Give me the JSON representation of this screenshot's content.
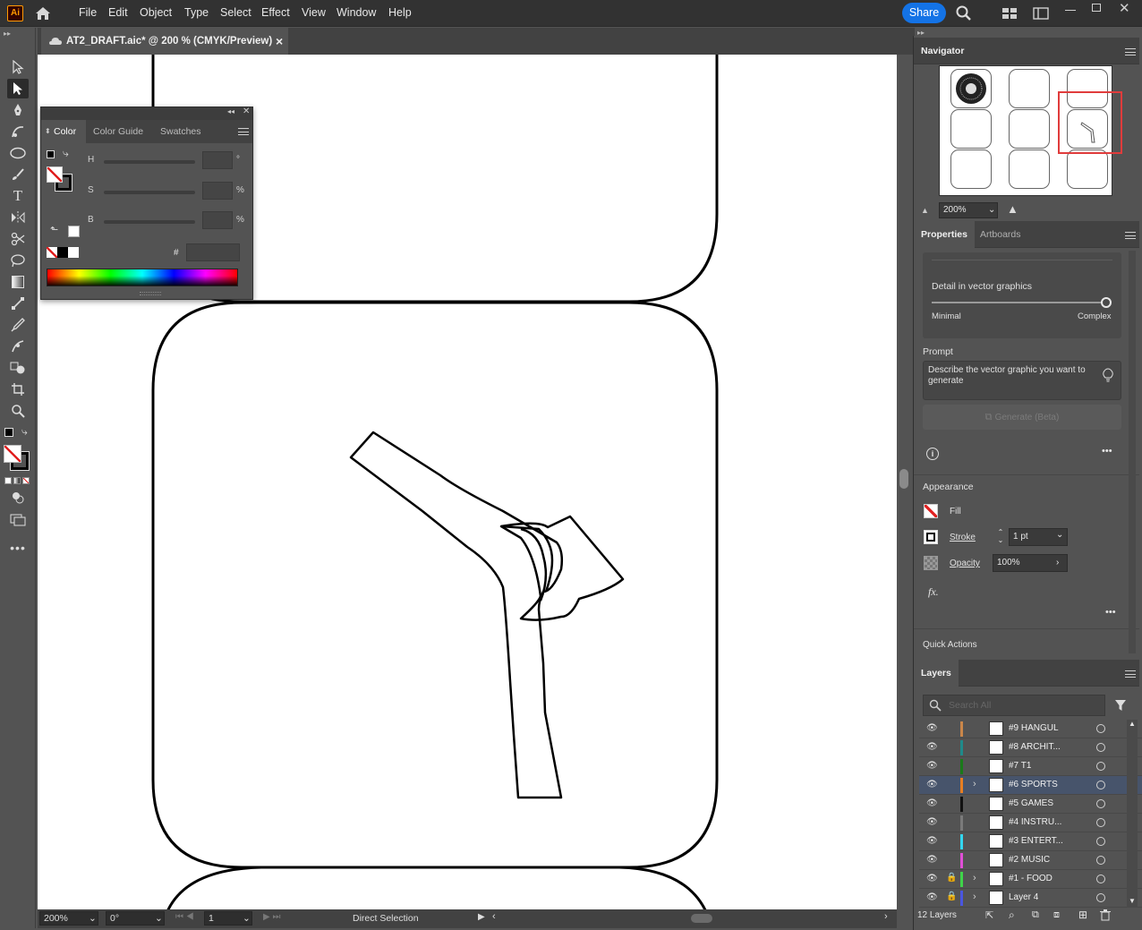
{
  "app": {
    "logo": "Ai",
    "share_label": "Share"
  },
  "menu": [
    "File",
    "Edit",
    "Object",
    "Type",
    "Select",
    "Effect",
    "View",
    "Window",
    "Help"
  ],
  "document": {
    "tab_title": "AT2_DRAFT.aic* @ 200 % (CMYK/Preview)",
    "close_glyph": "×"
  },
  "color_panel": {
    "tabs": [
      "Color",
      "Color Guide",
      "Swatches"
    ],
    "sliders": [
      {
        "label": "H",
        "unit": "°"
      },
      {
        "label": "S",
        "unit": "%"
      },
      {
        "label": "B",
        "unit": "%"
      }
    ],
    "hex_symbol": "#",
    "hex_value": ""
  },
  "status_bar": {
    "zoom": "200%",
    "rotation": "0°",
    "artboard": "1",
    "tool_name": "Direct Selection"
  },
  "navigator": {
    "title": "Navigator",
    "zoom": "200%"
  },
  "properties": {
    "tabs": [
      "Properties",
      "Artboards"
    ],
    "detail_label": "Detail in vector graphics",
    "detail_min": "Minimal",
    "detail_max": "Complex",
    "detail_level": 1.0,
    "prompt_label": "Prompt",
    "prompt_placeholder": "Describe the vector graphic you want to generate",
    "generate_label": "Generate (Beta)",
    "appearance_title": "Appearance",
    "fill_label": "Fill",
    "stroke_label": "Stroke",
    "stroke_value": "1 pt",
    "opacity_label": "Opacity",
    "opacity_value": "100%",
    "fx_label": "fx.",
    "quick_actions": "Quick Actions"
  },
  "layers": {
    "title": "Layers",
    "search_placeholder": "Search All",
    "count_label": "12 Layers",
    "items": [
      {
        "name": "#9 HANGUL",
        "color": "#c9864a",
        "selected": false,
        "expandable": false,
        "locked": false
      },
      {
        "name": "#8 ARCHIT...",
        "color": "#1f8a8a",
        "selected": false,
        "expandable": false,
        "locked": false
      },
      {
        "name": "#7 T1",
        "color": "#1a7a1a",
        "selected": false,
        "expandable": false,
        "locked": false
      },
      {
        "name": "#6 SPORTS",
        "color": "#e67e22",
        "selected": true,
        "expandable": true,
        "locked": false
      },
      {
        "name": "#5 GAMES",
        "color": "#111111",
        "selected": false,
        "expandable": false,
        "locked": false
      },
      {
        "name": "#4 INSTRU...",
        "color": "#7a7a7a",
        "selected": false,
        "expandable": false,
        "locked": false
      },
      {
        "name": "#3 ENTERT...",
        "color": "#33d6f0",
        "selected": false,
        "expandable": false,
        "locked": false
      },
      {
        "name": "#2 MUSIC",
        "color": "#e04fd6",
        "selected": false,
        "expandable": false,
        "locked": false
      },
      {
        "name": "#1 - FOOD",
        "color": "#3fd34a",
        "selected": false,
        "expandable": true,
        "locked": true
      },
      {
        "name": "Layer 4",
        "color": "#4a56e0",
        "selected": false,
        "expandable": true,
        "locked": true
      }
    ]
  },
  "colors": {
    "accent": "#1473e6",
    "selection": "#47546b",
    "nav_box": "#e03c3c"
  }
}
